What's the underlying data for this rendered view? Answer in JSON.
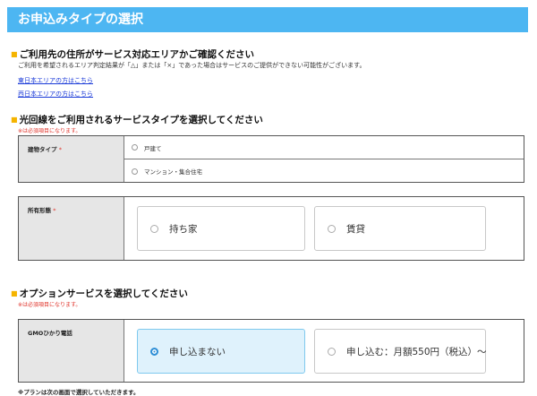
{
  "header": {
    "title": "お申込みタイプの選択"
  },
  "area_section": {
    "title": "ご利用先の住所がサービス対応エリアかご確認ください",
    "note": "ご利用を希望されるエリア判定結果が「△」または「×」であった場合はサービスのご提供ができない可能性がございます。",
    "links": [
      "東日本エリアの方はこちら",
      "西日本エリアの方はこちら"
    ]
  },
  "line_section": {
    "title": "光回線をご利用されるサービスタイプを選択してください",
    "required_note": "※は必須項目になります。",
    "building": {
      "label": "建物タイプ",
      "required_mark": "*",
      "options": [
        "戸建て",
        "マンション・集合住宅"
      ]
    },
    "ownership": {
      "label": "所有形態",
      "required_mark": "*",
      "options": [
        "持ち家",
        "賃貸"
      ]
    }
  },
  "option_section": {
    "title": "オプションサービスを選択してください",
    "required_note": "※は必須項目になります。",
    "phone": {
      "label": "GMOひかり電話",
      "options": [
        "申し込まない",
        "申し込む：月額550円（税込）～"
      ],
      "selected": "申し込まない"
    }
  },
  "footer_note": "※プランは次の画面で選択していただきます。",
  "colors": {
    "header_bg": "#4db6f2",
    "accent_square": "#f5b400",
    "required": "#e0332a",
    "link": "#1a3ad8",
    "selected_bg": "#dff2fc"
  }
}
